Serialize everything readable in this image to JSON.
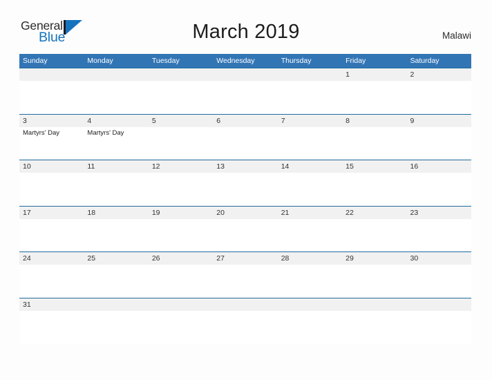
{
  "brand": {
    "name_part1": "General",
    "name_part2": "Blue",
    "flag_icon": "blue-flag-triangle-icon",
    "color_primary": "#1573be",
    "color_text": "#2b2b2b"
  },
  "header": {
    "title": "March 2019",
    "country": "Malawi"
  },
  "theme": {
    "header_blue": "#3275b5",
    "rule_blue": "#1f6a9e",
    "band_gray": "#f1f1f1",
    "page_background": "#fdfdfe"
  },
  "calendar": {
    "month": "March",
    "year": "2019",
    "weekday_headers": [
      "Sunday",
      "Monday",
      "Tuesday",
      "Wednesday",
      "Thursday",
      "Friday",
      "Saturday"
    ],
    "weeks": [
      {
        "days": [
          {
            "date": "",
            "events": []
          },
          {
            "date": "",
            "events": []
          },
          {
            "date": "",
            "events": []
          },
          {
            "date": "",
            "events": []
          },
          {
            "date": "",
            "events": []
          },
          {
            "date": "1",
            "events": []
          },
          {
            "date": "2",
            "events": []
          }
        ]
      },
      {
        "days": [
          {
            "date": "3",
            "events": [
              "Martyrs' Day"
            ]
          },
          {
            "date": "4",
            "events": [
              "Martyrs' Day"
            ]
          },
          {
            "date": "5",
            "events": []
          },
          {
            "date": "6",
            "events": []
          },
          {
            "date": "7",
            "events": []
          },
          {
            "date": "8",
            "events": []
          },
          {
            "date": "9",
            "events": []
          }
        ]
      },
      {
        "days": [
          {
            "date": "10",
            "events": []
          },
          {
            "date": "11",
            "events": []
          },
          {
            "date": "12",
            "events": []
          },
          {
            "date": "13",
            "events": []
          },
          {
            "date": "14",
            "events": []
          },
          {
            "date": "15",
            "events": []
          },
          {
            "date": "16",
            "events": []
          }
        ]
      },
      {
        "days": [
          {
            "date": "17",
            "events": []
          },
          {
            "date": "18",
            "events": []
          },
          {
            "date": "19",
            "events": []
          },
          {
            "date": "20",
            "events": []
          },
          {
            "date": "21",
            "events": []
          },
          {
            "date": "22",
            "events": []
          },
          {
            "date": "23",
            "events": []
          }
        ]
      },
      {
        "days": [
          {
            "date": "24",
            "events": []
          },
          {
            "date": "25",
            "events": []
          },
          {
            "date": "26",
            "events": []
          },
          {
            "date": "27",
            "events": []
          },
          {
            "date": "28",
            "events": []
          },
          {
            "date": "29",
            "events": []
          },
          {
            "date": "30",
            "events": []
          }
        ]
      },
      {
        "days": [
          {
            "date": "31",
            "events": []
          },
          {
            "date": "",
            "events": []
          },
          {
            "date": "",
            "events": []
          },
          {
            "date": "",
            "events": []
          },
          {
            "date": "",
            "events": []
          },
          {
            "date": "",
            "events": []
          },
          {
            "date": "",
            "events": []
          }
        ]
      }
    ]
  }
}
